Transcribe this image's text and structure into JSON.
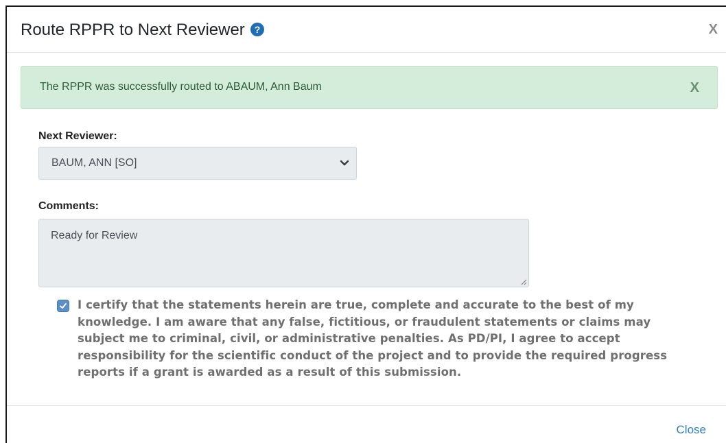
{
  "modal": {
    "title": "Route RPPR to Next Reviewer",
    "close_label": "X",
    "help_icon": "question-circle-icon"
  },
  "alert": {
    "message": "The RPPR was successfully routed to ABAUM, Ann Baum",
    "close_label": "X",
    "background": "#d4eddb",
    "text_color": "#2c5b36"
  },
  "form": {
    "next_reviewer_label": "Next Reviewer:",
    "next_reviewer_value": "BAUM, ANN [SO]",
    "comments_label": "Comments:",
    "comments_value": "Ready for Review",
    "certification_checked": true,
    "certification_text": "I certify that the statements herein are true, complete and accurate to the best of my knowledge. I am aware that any false, fictitious, or fraudulent statements or claims may subject me to criminal, civil, or administrative penalties. As PD/PI, I agree to accept responsibility for the scientific conduct of the project and to provide the required progress reports if a grant is awarded as a result of this submission."
  },
  "footer": {
    "close_label": "Close",
    "link_color": "#2f7fbf"
  }
}
